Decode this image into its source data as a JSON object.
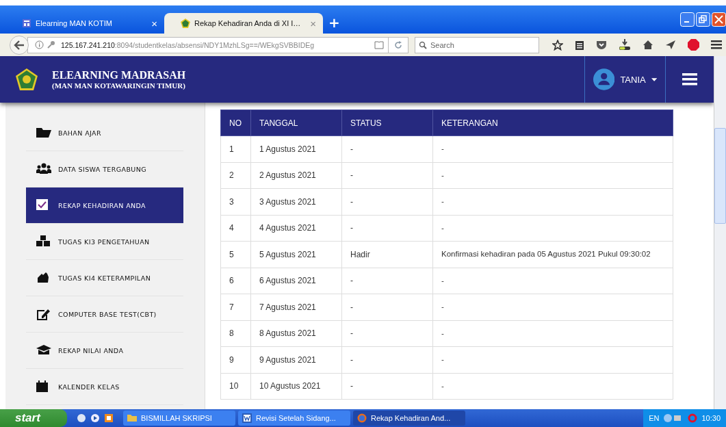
{
  "browser": {
    "tabs": [
      {
        "title": "Elearning MAN KOTIM",
        "selected": false,
        "close": "×"
      },
      {
        "title": "Rekap Kehadiran Anda di XI I…",
        "selected": true,
        "close": "×"
      }
    ],
    "new_tab": "+",
    "url_host": "125.167.241.210",
    "url_path": ":8094/studentkelas/absensi/NDY1MzhLSg==/WEkgSVBBIDEg",
    "search": {
      "placeholder": "Search"
    }
  },
  "header": {
    "title": "ELEARNING MADRASAH",
    "subtitle": "(MAN MAN KOTAWARINGIN TIMUR)",
    "user": "TANIA"
  },
  "sidebar": {
    "items": [
      {
        "label": "BAHAN AJAR",
        "selected": false
      },
      {
        "label": "DATA SISWA TERGABUNG",
        "selected": false
      },
      {
        "label": "REKAP KEHADIRAN ANDA",
        "selected": true
      },
      {
        "label": "TUGAS KI3 PENGETAHUAN",
        "selected": false
      },
      {
        "label": "TUGAS KI4 KETERAMPILAN",
        "selected": false
      },
      {
        "label": "COMPUTER BASE TEST(CBT)",
        "selected": false
      },
      {
        "label": "REKAP NILAI ANDA",
        "selected": false
      },
      {
        "label": "KALENDER KELAS",
        "selected": false
      }
    ]
  },
  "table": {
    "columns": [
      "NO",
      "TANGGAL",
      "STATUS",
      "KETERANGAN"
    ],
    "rows": [
      [
        "1",
        "1 Agustus 2021",
        "-",
        "-"
      ],
      [
        "2",
        "2 Agustus 2021",
        "-",
        "-"
      ],
      [
        "3",
        "3 Agustus 2021",
        "-",
        "-"
      ],
      [
        "4",
        "4 Agustus 2021",
        "-",
        "-"
      ],
      [
        "5",
        "5 Agustus 2021",
        "Hadir",
        "Konfirmasi kehadiran pada 05 Agustus 2021 Pukul 09:30:02"
      ],
      [
        "6",
        "6 Agustus 2021",
        "-",
        "-"
      ],
      [
        "7",
        "7 Agustus 2021",
        "-",
        "-"
      ],
      [
        "8",
        "8 Agustus 2021",
        "-",
        "-"
      ],
      [
        "9",
        "9 Agustus 2021",
        "-",
        "-"
      ],
      [
        "10",
        "10 Agustus 2021",
        "-",
        "-"
      ]
    ]
  },
  "taskbar": {
    "start": "start",
    "windows": [
      {
        "title": "BISMILLAH SKRIPSI",
        "selected": false
      },
      {
        "title": "Revisi Setelah Sidang...",
        "selected": false
      },
      {
        "title": "Rekap Kehadiran And...",
        "selected": true
      }
    ],
    "language": "EN",
    "clock": "10:30"
  }
}
